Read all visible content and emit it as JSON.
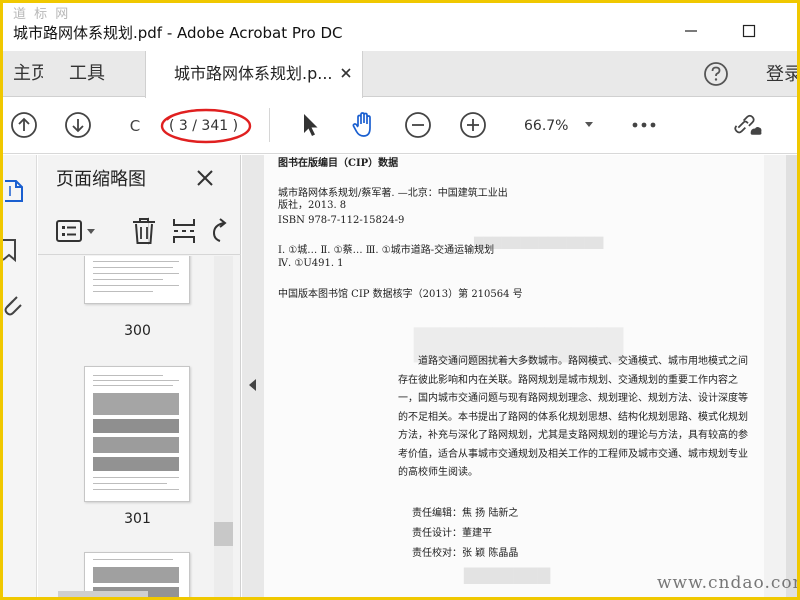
{
  "window": {
    "title": "城市路网体系规划.pdf - Adobe Acrobat Pro DC",
    "watermark_top": "道 标 网"
  },
  "tabs": {
    "home_label": "主页",
    "tools_label": "工具",
    "document_tab_label": "城市路网体系规划.p...",
    "login_label": "登录"
  },
  "toolbar": {
    "page_current": "C",
    "page_count": "( 3 / 341 )",
    "zoom": "66.7%",
    "annotation_color": "#e02020"
  },
  "thumbnail_panel": {
    "title": "页面缩略图",
    "pages": [
      "300",
      "301"
    ]
  },
  "document": {
    "cip_heading": "图书在版编目（CIP）数据",
    "cip_line1": "城市路网体系规划/蔡军著. —北京：中国建筑工业出",
    "cip_line2": "版社，2013. 8",
    "isbn": "ISBN 978-7-112-15824-9",
    "classification_line1": "Ⅰ. ①城…   Ⅱ. ①蔡…   Ⅲ. ①城市道路-交通运输规划",
    "classification_line2": "Ⅳ. ①U491. 1",
    "cip_record": "中国版本图书馆 CIP 数据核字（2013）第 210564 号",
    "abstract": "道路交通问题困扰着大多数城市。路网模式、交通模式、城市用地模式之间存在彼此影响和内在关联。路网规划是城市规划、交通规划的重要工作内容之一，国内城市交通问题与现有路网规划理念、规划理论、规划方法、设计深度等的不足相关。本书提出了路网的体系化规划思想、结构化规划思路、模式化规划方法，补充与深化了路网规划，尤其是支路网规划的理论与方法，具有较高的参考价值，适合从事城市交通规划及相关工作的工程师及城市交通、城市规划专业的高校师生阅读。",
    "credits": [
      {
        "role": "责任编辑：",
        "names": "焦   扬   陆新之"
      },
      {
        "role": "责任设计：",
        "names": "董建平"
      },
      {
        "role": "责任校对：",
        "names": "张   颖   陈晶晶"
      }
    ]
  },
  "watermark_bottom": "www.cndao.com",
  "icons": [
    "arrow-up-circle-icon",
    "arrow-down-circle-icon",
    "select-arrow-icon",
    "hand-icon",
    "zoom-out-icon",
    "zoom-in-icon",
    "more-icon",
    "share-link-icon",
    "help-icon",
    "close-icon",
    "page-thumbnails-icon",
    "bookmark-icon",
    "attachment-icon",
    "options-icon",
    "delete-icon",
    "insert-page-icon",
    "rotate-icon",
    "collapse-left-icon"
  ]
}
